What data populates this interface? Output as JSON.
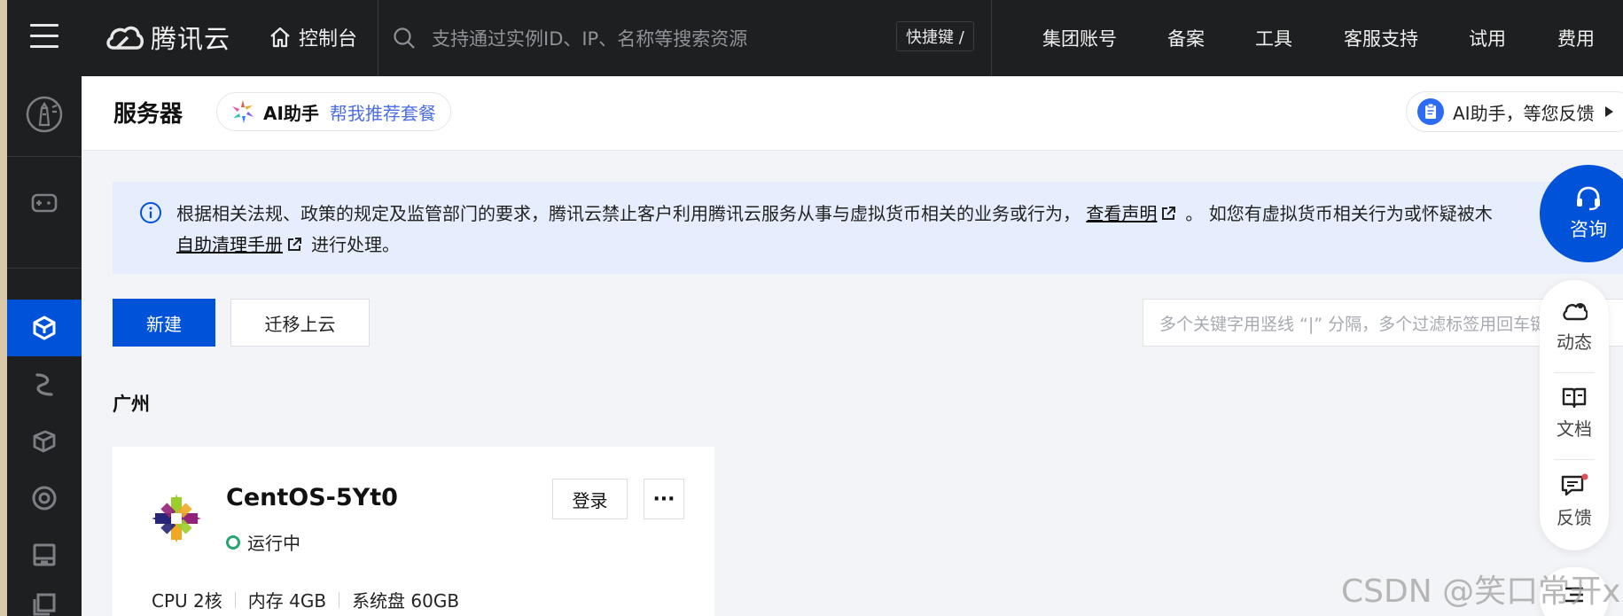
{
  "topbar": {
    "brand": "腾讯云",
    "console": "控制台",
    "search_placeholder": "支持通过实例ID、IP、名称等搜索资源",
    "shortcut": "快捷键 /",
    "nav": [
      "集团账号",
      "备案",
      "工具",
      "客服支持",
      "试用",
      "费用"
    ]
  },
  "header": {
    "title": "服务器",
    "ai_name": "AI助手",
    "ai_suggest": "帮我推荐套餐",
    "ai_feedback": "AI助手，等您反馈"
  },
  "notice": {
    "text1": "根据相关法规、政策的规定及监管部门的要求，腾讯云禁止客户利用腾讯云服务从事与虚拟货币相关的业务或行为，",
    "link1": "查看声明",
    "text2": "。 如您有虚拟货币相关行为或怀疑被木",
    "link2": "自助清理手册",
    "text3": "进行处理。"
  },
  "actions": {
    "new": "新建",
    "migrate": "迁移上云",
    "filter_placeholder": "多个关键字用竖线 “|” 分隔，多个过滤标签用回车键分隔"
  },
  "region": "广州",
  "server": {
    "name": "CentOS-5Yt0",
    "status": "运行中",
    "login": "登录",
    "more": "···",
    "specs": [
      "CPU 2核",
      "内存 4GB",
      "系统盘 60GB"
    ]
  },
  "float": {
    "consult": "咨询",
    "items": [
      "动态",
      "文档",
      "反馈"
    ]
  },
  "colors": {
    "primary": "#0052d9",
    "topbar_bg": "#1e1f21",
    "notice_bg": "#e6edfd",
    "running": "#2ba471"
  },
  "watermark": "CSDN @笑口常开xpr"
}
